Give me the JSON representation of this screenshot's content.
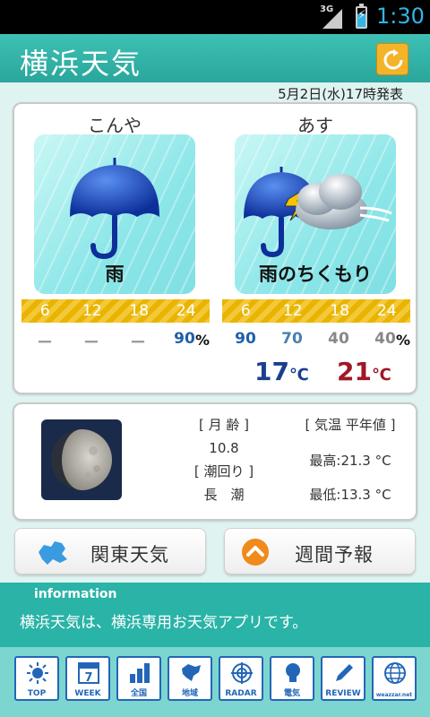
{
  "status_bar": {
    "network": "3G",
    "time": "1:30"
  },
  "header": {
    "title": "横浜天気",
    "refresh_icon": "refresh-icon"
  },
  "issued": "5月2日(水)17時発表",
  "forecast": {
    "today": {
      "label": "こんや",
      "weather": "雨",
      "icon": "umbrella-icon",
      "hours": [
        "6",
        "12",
        "18",
        "24"
      ],
      "probabilities": [
        "ー",
        "ー",
        "ー",
        "90"
      ]
    },
    "tomorrow": {
      "label": "あす",
      "weather": "雨のちくもり",
      "icon": "umbrella-cloud-icon",
      "hours": [
        "6",
        "12",
        "18",
        "24"
      ],
      "probabilities": [
        "90",
        "70",
        "40",
        "40"
      ],
      "low": "17",
      "high": "21"
    },
    "percent_unit": "%",
    "temp_unit": "℃"
  },
  "info": {
    "moon_age_label": "[ 月 齢 ]",
    "moon_age": "10.8",
    "tide_label": "[ 潮回り ]",
    "tide": "長　潮",
    "normal_label": "[ 気温 平年値 ]",
    "normal_high": "最高:21.3 °C",
    "normal_low": "最低:13.3 °C"
  },
  "buttons": {
    "kanto": "関東天気",
    "weekly": "週間予報"
  },
  "information": {
    "heading": "information",
    "message": "横浜天気は、横浜専用お天気アプリです。"
  },
  "nav": {
    "items": [
      {
        "label": "TOP",
        "icon": "sun-icon"
      },
      {
        "label": "WEEK",
        "icon": "calendar-icon",
        "badge": "7"
      },
      {
        "label": "全国",
        "icon": "bar-chart-icon"
      },
      {
        "label": "地域",
        "icon": "hokkaido-map-icon"
      },
      {
        "label": "RADAR",
        "icon": "radar-icon"
      },
      {
        "label": "電気",
        "icon": "lightbulb-icon"
      },
      {
        "label": "REVIEW",
        "icon": "pencil-icon"
      },
      {
        "label": "weazzar.net",
        "icon": "globe-icon"
      }
    ]
  },
  "colors": {
    "accent": "#2ab3a7",
    "probability_blue": "#1f5fa8",
    "probability_gray": "#888888",
    "temp_low": "#1a3f8f",
    "temp_high": "#a01728",
    "strip_yellow": "#e8b400"
  }
}
